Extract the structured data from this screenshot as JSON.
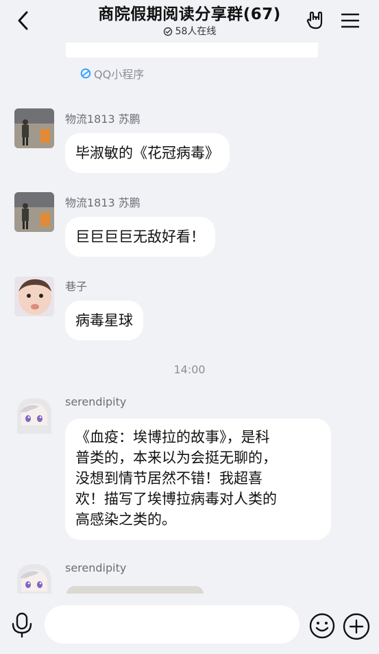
{
  "header": {
    "title": "商院假期阅读分享群(67)",
    "online_status": "58人在线",
    "back_icon": "chevron-left-icon",
    "hand_icon": "rock-hand-icon",
    "menu_icon": "hamburger-menu-icon"
  },
  "miniprogram": {
    "label": "QQ小程序",
    "icon": "miniprogram-icon",
    "icon_color": "#3aa0ff"
  },
  "messages": [
    {
      "sender": "物流1813 苏鹏",
      "text": "毕淑敏的《花冠病毒》",
      "avatar": "avatar-person-outdoor"
    },
    {
      "sender": "物流1813 苏鹏",
      "text": "巨巨巨巨无敌好看！",
      "avatar": "avatar-person-outdoor"
    },
    {
      "sender": "巷子",
      "text": "病毒星球",
      "avatar": "avatar-baby"
    },
    {
      "sender": "serendipity",
      "lines": [
        "《血疫：埃博拉的故事》，是科",
        "普类的，本来以为会挺无聊的，",
        "没想到情节居然不错！我超喜",
        "欢！描写了埃博拉病毒对人类的",
        "高感染之类的。"
      ],
      "avatar": "avatar-anime-girl"
    },
    {
      "sender": "serendipity",
      "text": "",
      "avatar": "avatar-anime-girl"
    }
  ],
  "timestamp": "14:00",
  "input_bar": {
    "placeholder": "",
    "mic_icon": "microphone-icon",
    "emoji_icon": "smiley-icon",
    "plus_icon": "plus-circle-icon"
  },
  "colors": {
    "background": "#f1f2f6",
    "bubble": "#ffffff",
    "meta_text": "#8b8f99"
  }
}
